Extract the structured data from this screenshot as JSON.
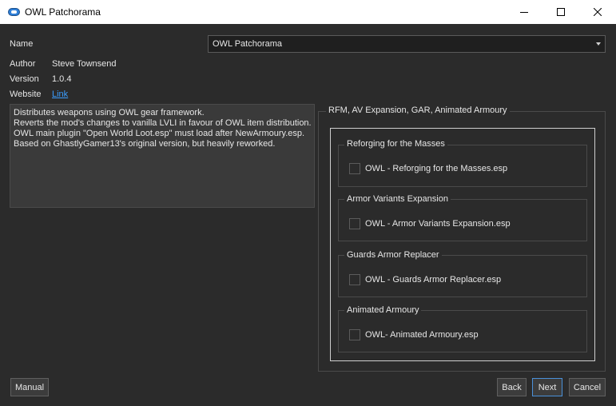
{
  "window": {
    "title": "OWL Patchorama"
  },
  "fields": {
    "name_label": "Name",
    "name_value": "OWL Patchorama",
    "author_label": "Author",
    "author_value": "Steve Townsend",
    "version_label": "Version",
    "version_value": "1.0.4",
    "website_label": "Website",
    "website_value": "Link"
  },
  "description": [
    "Distributes weapons using OWL gear framework.",
    "Reverts the mod's changes to vanilla LVLI in favour of OWL item distribution.",
    "OWL main plugin \"Open World Loot.esp\" must load after NewArmoury.esp.",
    "Based on GhastlyGamer13's original version, but heavily reworked."
  ],
  "options_group": {
    "title": "RFM, AV Expansion, GAR, Animated Armoury",
    "groups": [
      {
        "title": "Reforging for the Masses",
        "option": "OWL - Reforging for the Masses.esp",
        "checked": false
      },
      {
        "title": "Armor Variants Expansion",
        "option": "OWL - Armor Variants Expansion.esp",
        "checked": false
      },
      {
        "title": "Guards Armor Replacer",
        "option": "OWL - Guards Armor Replacer.esp",
        "checked": false
      },
      {
        "title": "Animated Armoury",
        "option": "OWL- Animated Armoury.esp",
        "checked": false
      }
    ]
  },
  "buttons": {
    "manual": "Manual",
    "back": "Back",
    "next": "Next",
    "cancel": "Cancel"
  },
  "colors": {
    "background": "#2b2b2b",
    "link": "#3b9eff",
    "accent": "#4a90d9"
  }
}
